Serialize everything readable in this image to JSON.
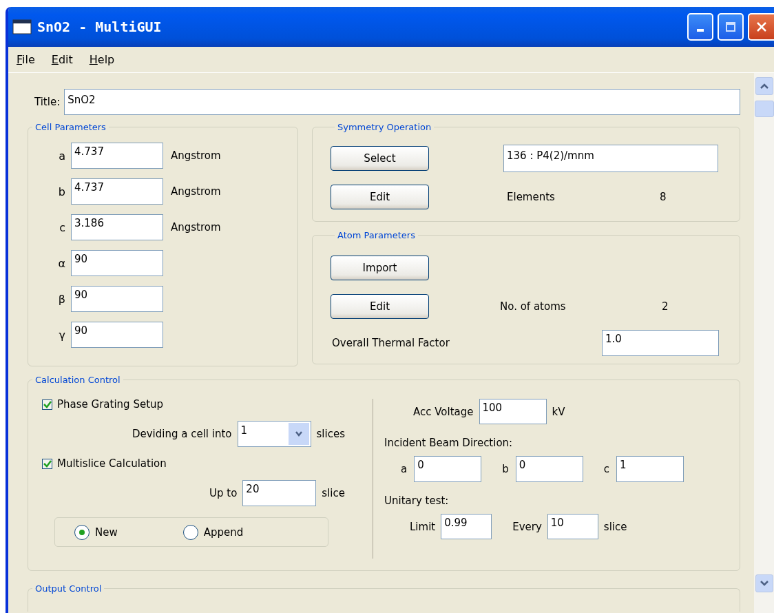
{
  "window": {
    "title": "SnO2 - MultiGUI"
  },
  "menu": [
    {
      "label": "File"
    },
    {
      "label": "Edit"
    },
    {
      "label": "Help"
    }
  ],
  "title_field": {
    "label": "Title:",
    "value": "SnO2"
  },
  "cell_parameters": {
    "title": "Cell Parameters",
    "rows": [
      {
        "label": "a",
        "value": "4.737",
        "unit": "Angstrom"
      },
      {
        "label": "b",
        "value": "4.737",
        "unit": "Angstrom"
      },
      {
        "label": "c",
        "value": "3.186",
        "unit": "Angstrom"
      },
      {
        "label": "α",
        "value": "90"
      },
      {
        "label": "β",
        "value": "90"
      },
      {
        "label": "γ",
        "value": "90"
      }
    ]
  },
  "symmetry": {
    "title": "Symmetry Operation",
    "select_button": "Select",
    "edit_button": "Edit",
    "space_group": "136 : P4(2)/mnm",
    "elements_label": "Elements",
    "elements_value": "8"
  },
  "atoms": {
    "title": "Atom Parameters",
    "import_button": "Import",
    "edit_button": "Edit",
    "count_label": "No. of atoms",
    "count_value": "2",
    "thermal_label": "Overall Thermal Factor",
    "thermal_value": "1.0"
  },
  "calculation": {
    "title": "Calculation Control",
    "phase_grating": {
      "label": "Phase Grating Setup",
      "checked": true
    },
    "dividing": {
      "label": "Deviding a cell into",
      "value": "1",
      "unit": "slices"
    },
    "multislice": {
      "label": "Multislice Calculation",
      "checked": true
    },
    "up_to": {
      "label": "Up to",
      "value": "20",
      "unit": "slice"
    },
    "modes": [
      {
        "label": "New",
        "selected": true
      },
      {
        "label": "Append",
        "selected": false
      }
    ],
    "acc_voltage": {
      "label": "Acc Voltage",
      "value": "100",
      "unit": "kV"
    },
    "beam": {
      "label": "Incident Beam Direction:",
      "components": [
        {
          "axis": "a",
          "value": "0"
        },
        {
          "axis": "b",
          "value": "0"
        },
        {
          "axis": "c",
          "value": "1"
        }
      ]
    },
    "unitary": {
      "label": "Unitary test:",
      "limit_label": "Limit",
      "limit_value": "0.99",
      "every_label": "Every",
      "every_value": "10",
      "unit": "slice"
    }
  },
  "output_control": {
    "title": "Output Control"
  }
}
